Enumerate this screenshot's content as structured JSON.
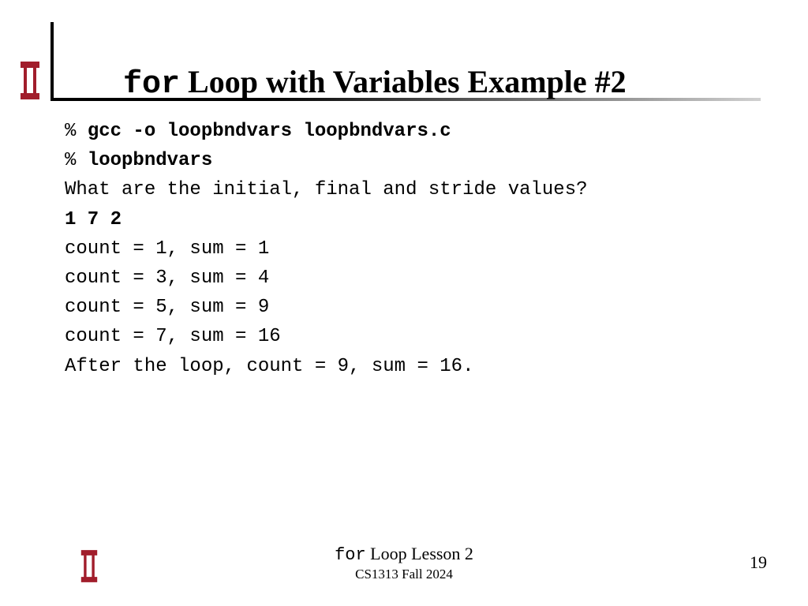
{
  "title": {
    "keyword": "for",
    "rest": " Loop with Variables Example #2"
  },
  "code": {
    "l1_prompt": "% ",
    "l1_cmd": "gcc -o loopbndvars loopbndvars.c",
    "l2_prompt": "% ",
    "l2_cmd": "loopbndvars",
    "l3": "What are the initial, final and stride values?",
    "l4": "1 7 2",
    "l5": "count = 1, sum = 1",
    "l6": "count = 3, sum = 4",
    "l7": "count = 5, sum = 9",
    "l8": "count = 7, sum = 16",
    "l9": "After the loop, count = 9, sum = 16."
  },
  "footer": {
    "line1_mono": "for",
    "line1_rest": " Loop Lesson 2",
    "line2": "CS1313 Fall 2024"
  },
  "page_number": "19"
}
